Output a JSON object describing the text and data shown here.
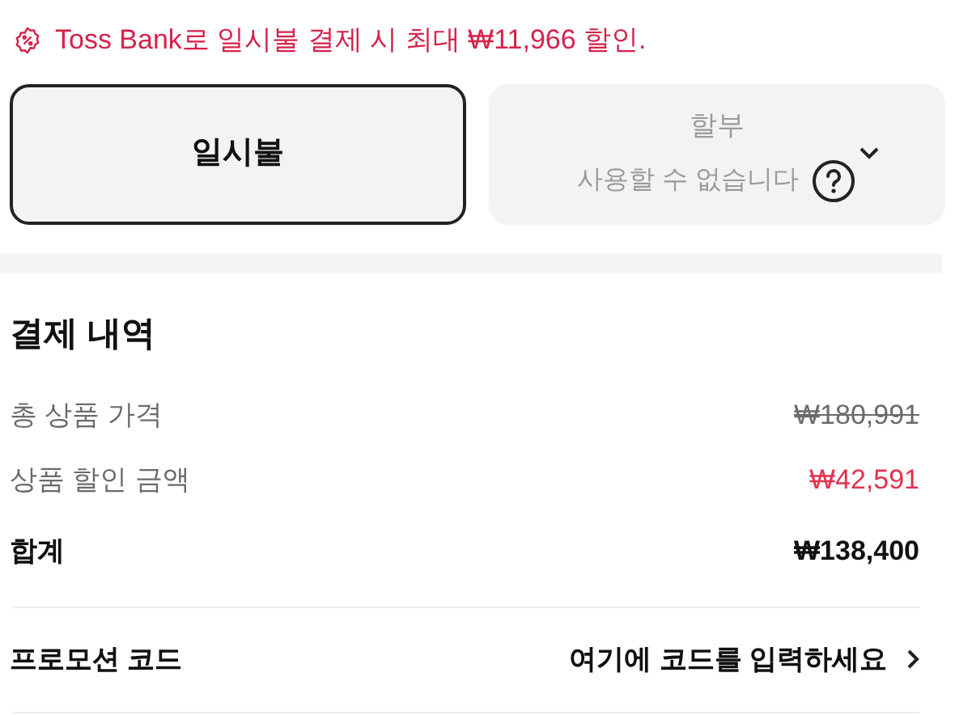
{
  "promo_banner": {
    "text": "Toss Bank로 일시불 결제 시 최대 ₩11,966 할인."
  },
  "payment_options": [
    {
      "label": "일시불",
      "selected": true,
      "disabled": false
    },
    {
      "label": "할부",
      "note": "사용할 수 없습니다",
      "selected": false,
      "disabled": true
    }
  ],
  "summary": {
    "title": "결제 내역",
    "rows": [
      {
        "kind": "original",
        "label": "총 상품 가격",
        "value": "₩180,991"
      },
      {
        "kind": "discount",
        "label": "상품 할인 금액",
        "value": "₩42,591"
      },
      {
        "kind": "total",
        "label": "합계",
        "value": "₩138,400"
      }
    ]
  },
  "promotion": {
    "label": "프로모션 코드",
    "placeholder": "여기에 코드를 입력하세요"
  }
}
